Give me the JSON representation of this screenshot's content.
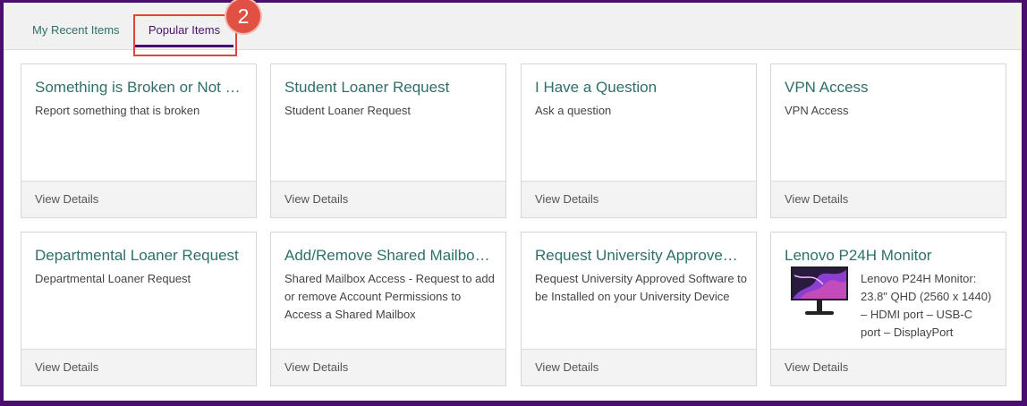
{
  "tabs": [
    {
      "label": "My Recent Items"
    },
    {
      "label": "Popular Items"
    }
  ],
  "annotation": {
    "number": "2"
  },
  "cards": [
    {
      "title": "Something is Broken or Not …",
      "desc": "Report something that is broken",
      "footer": "View Details"
    },
    {
      "title": "Student Loaner Request",
      "desc": "Student Loaner Request",
      "footer": "View Details"
    },
    {
      "title": "I Have a Question",
      "desc": "Ask a question",
      "footer": "View Details"
    },
    {
      "title": "VPN Access",
      "desc": "VPN Access",
      "footer": "View Details"
    },
    {
      "title": "Departmental Loaner Request",
      "desc": "Departmental Loaner Request",
      "footer": "View Details"
    },
    {
      "title": "Add/Remove Shared Mailbo…",
      "desc": "Shared Mailbox Access - Request to add or remove Account Permissions to Access a Shared Mailbox",
      "footer": "View Details"
    },
    {
      "title": "Request University Approve…",
      "desc": "Request University Approved Software to be Installed on your University Device",
      "footer": "View Details"
    },
    {
      "title": "Lenovo P24H Monitor",
      "desc": "Lenovo P24H Monitor: 23.8\" QHD (2560 x 1440) – HDMI port – USB-C port – DisplayPort",
      "footer": "View Details",
      "image": "monitor-image"
    }
  ]
}
